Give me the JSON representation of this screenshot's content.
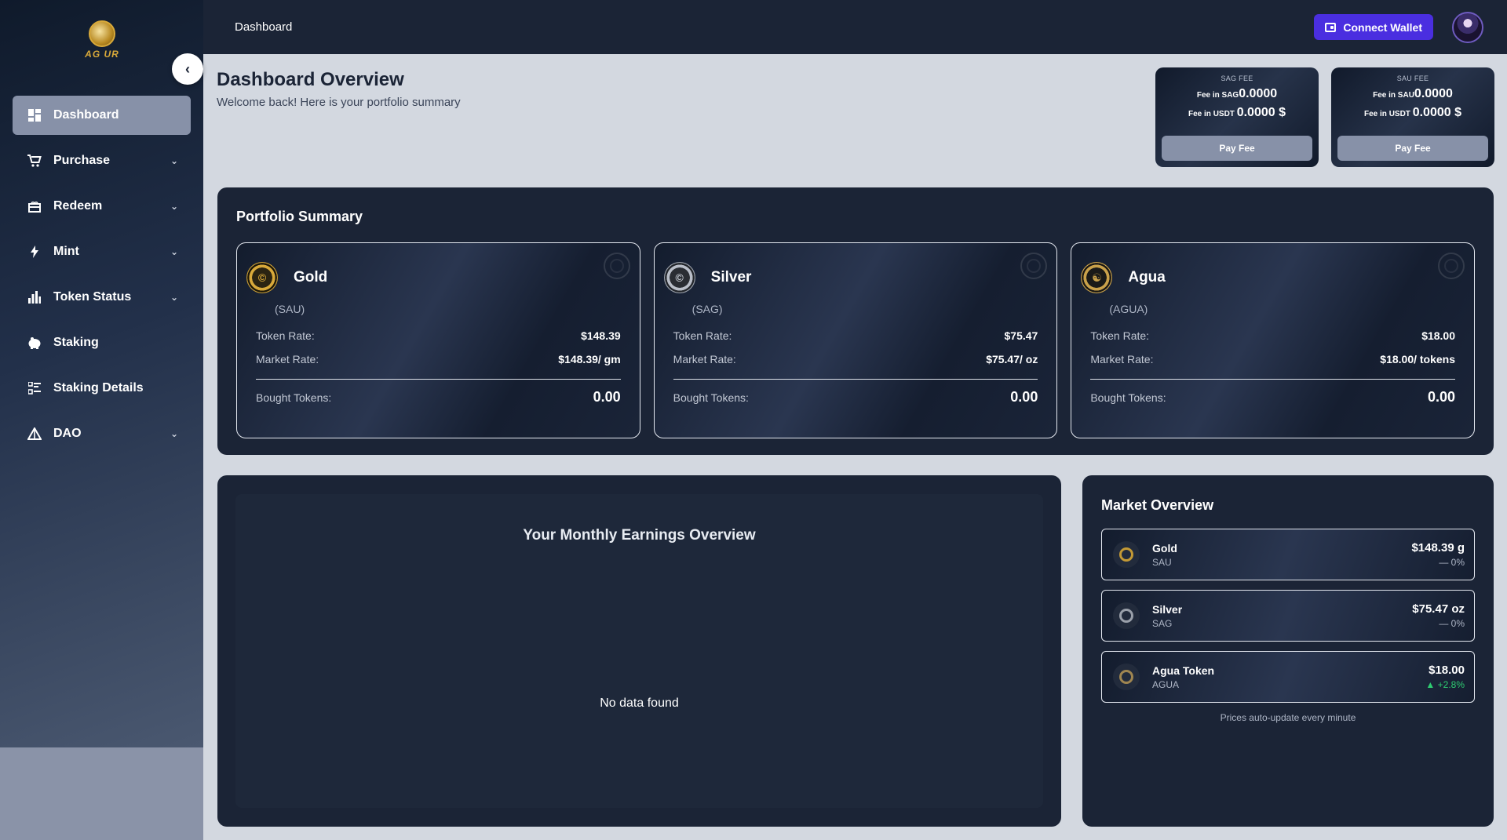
{
  "logo": {
    "text": "AG UR"
  },
  "topbar": {
    "title": "Dashboard",
    "connect_label": "Connect Wallet"
  },
  "sidebar": {
    "items": [
      {
        "label": "Dashboard",
        "icon": "grid-icon",
        "active": true,
        "chevron": false
      },
      {
        "label": "Purchase",
        "icon": "cart-icon",
        "active": false,
        "chevron": true
      },
      {
        "label": "Redeem",
        "icon": "gift-icon",
        "active": false,
        "chevron": true
      },
      {
        "label": "Mint",
        "icon": "bolt-icon",
        "active": false,
        "chevron": true
      },
      {
        "label": "Token Status",
        "icon": "bar-chart-icon",
        "active": false,
        "chevron": true
      },
      {
        "label": "Staking",
        "icon": "piggy-bank-icon",
        "active": false,
        "chevron": false
      },
      {
        "label": "Staking Details",
        "icon": "list-details-icon",
        "active": false,
        "chevron": false
      },
      {
        "label": "DAO",
        "icon": "dao-icon",
        "active": false,
        "chevron": true
      }
    ]
  },
  "header": {
    "title": "Dashboard Overview",
    "subtitle": "Welcome back! Here is your portfolio summary"
  },
  "fees": [
    {
      "label": "SAG FEE",
      "token_prefix": "Fee in SAG",
      "token_value": "0.0000",
      "usdt_prefix": "Fee in USDT",
      "usdt_value": "0.0000 $",
      "button": "Pay Fee"
    },
    {
      "label": "SAU FEE",
      "token_prefix": "Fee in SAU",
      "token_value": "0.0000",
      "usdt_prefix": "Fee in USDT",
      "usdt_value": "0.0000 $",
      "button": "Pay Fee"
    }
  ],
  "portfolio": {
    "title": "Portfolio Summary",
    "labels": {
      "token_rate": "Token Rate:",
      "market_rate": "Market Rate:",
      "bought": "Bought Tokens:"
    },
    "tokens": [
      {
        "name": "Gold",
        "symbol": "(SAU)",
        "token_rate": "$148.39",
        "market_rate": "$148.39/ gm",
        "bought": "0.00"
      },
      {
        "name": "Silver",
        "symbol": "(SAG)",
        "token_rate": "$75.47",
        "market_rate": "$75.47/ oz",
        "bought": "0.00"
      },
      {
        "name": "Agua",
        "symbol": "(AGUA)",
        "token_rate": "$18.00",
        "market_rate": "$18.00/ tokens",
        "bought": "0.00"
      }
    ]
  },
  "earnings": {
    "title": "Your Monthly Earnings Overview",
    "empty": "No data found"
  },
  "market": {
    "title": "Market Overview",
    "items": [
      {
        "name": "Gold",
        "symbol": "SAU",
        "price": "$148.39 g",
        "change": "— 0%"
      },
      {
        "name": "Silver",
        "symbol": "SAG",
        "price": "$75.47 oz",
        "change": "— 0%"
      },
      {
        "name": "Agua Token",
        "symbol": "AGUA",
        "price": "$18.00",
        "change": "▲ +2.8%"
      }
    ],
    "note": "Prices auto-update every minute"
  },
  "colors": {
    "accent": "#4a2ee0",
    "panel": "#1b2436",
    "gold": "#d8a93a",
    "positive": "#2ecc71"
  }
}
